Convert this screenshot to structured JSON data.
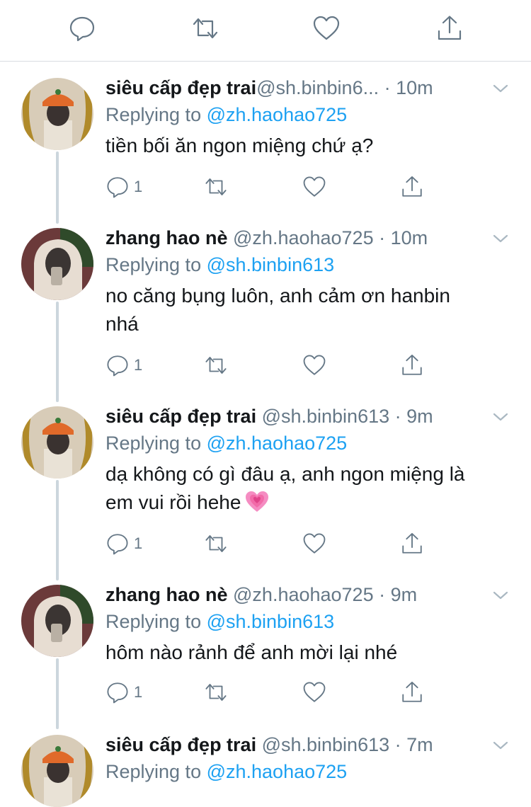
{
  "colors": {
    "accent": "#1da1f2",
    "muted": "#657786",
    "text": "#14171a",
    "line": "#ccd6dd"
  },
  "top_actions": [
    "reply-icon",
    "retweet-icon",
    "like-icon",
    "share-icon"
  ],
  "tweets": [
    {
      "name": "siêu cấp đẹp trai",
      "handle": "@sh.binbin6... ",
      "meta": "· 10m",
      "replying_label": "Replying to ",
      "replying_to": "@zh.haohao725",
      "text_lines": [
        "tiền bối ăn ngon miệng chứ ạ?"
      ],
      "reply_count": "1",
      "avatar": "orange-hat-avatar"
    },
    {
      "name": "zhang hao nè",
      "handle": " @zh.haohao725",
      "meta": " · 10m",
      "replying_label": "Replying to ",
      "replying_to": "@sh.binbin613",
      "text_lines": [
        "no căng bụng luôn, anh cảm ơn hanbin",
        "nhá"
      ],
      "reply_count": "1",
      "avatar": "hood-avatar"
    },
    {
      "name": "siêu cấp đẹp trai",
      "handle": " @sh.binbin613",
      "meta": " · 9m",
      "replying_label": "Replying to ",
      "replying_to": "@zh.haohao725",
      "text_lines": [
        "dạ không có gì đâu ạ, anh ngon miệng là",
        "em vui rồi hehe"
      ],
      "emoji": "growing-heart-emoji",
      "reply_count": "1",
      "avatar": "orange-hat-avatar"
    },
    {
      "name": "zhang hao nè",
      "handle": " @zh.haohao725",
      "meta": " · 9m",
      "replying_label": "Replying to ",
      "replying_to": "@sh.binbin613",
      "text_lines": [
        "hôm nào rảnh để anh mời lại nhé"
      ],
      "reply_count": "1",
      "avatar": "hood-avatar"
    },
    {
      "name": "siêu cấp đẹp trai",
      "handle": " @sh.binbin613",
      "meta": " · 7m",
      "replying_label": "Replying to ",
      "replying_to": "@zh.haohao725",
      "avatar": "orange-hat-avatar"
    }
  ]
}
